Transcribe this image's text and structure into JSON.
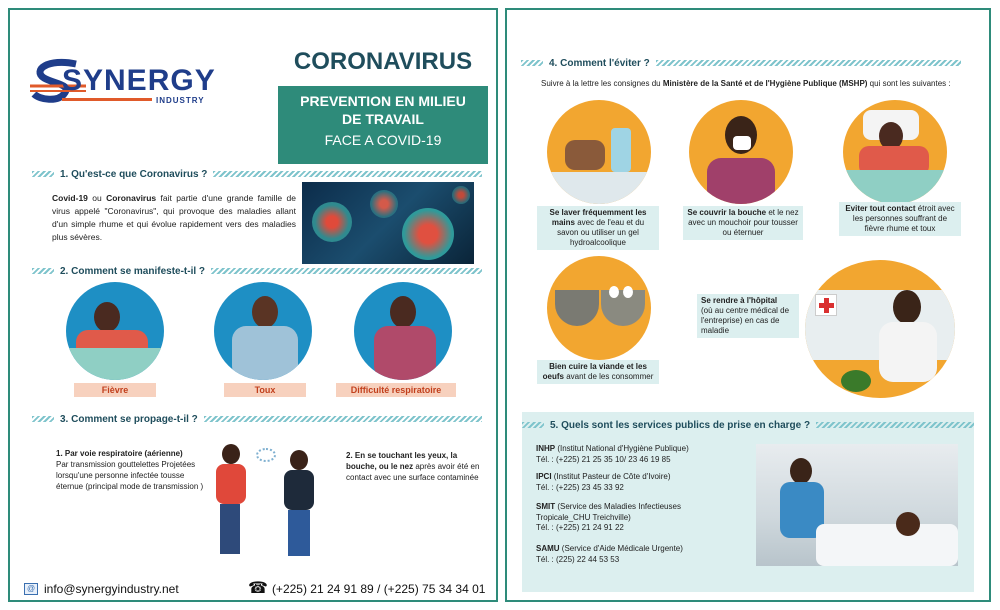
{
  "left": {
    "logo": {
      "name": "SYNERGY",
      "sub": "INDUSTRY"
    },
    "title": "CORONAVIRUS",
    "box_line1": "PREVENTION EN MILIEU",
    "box_line2": "DE TRAVAIL",
    "box_line3": "FACE A COVID-19",
    "s1": {
      "heading": "1. Qu'est-ce que Coronavirus ?",
      "t1": "Covid-19",
      "t2": " ou ",
      "t3": "Coronavirus",
      "t4": " fait partie d'une grande famille de virus appelé \"Coronavirus\", qui provoque des maladies allant d'un simple rhume et qui évolue rapidement vers des maladies plus sévères."
    },
    "s2": {
      "heading": "2. Comment se manifeste-t-il ?",
      "symptoms": [
        "Fièvre",
        "Toux",
        "Difficulté respiratoire"
      ]
    },
    "s3": {
      "heading": "3. Comment se propage-t-il ?",
      "r1_title": "1. Par voie respiratoire (aérienne)",
      "r1_text": "Par transmission gouttelettes Projetées lorsqu'une personne infectée tousse éternue (principal mode de transmission )",
      "r2_bold": "2. En se touchant les yeux, la bouche, ou le nez",
      "r2_text": " après avoir été en contact avec une surface contaminée"
    },
    "footer": {
      "email": "info@synergyindustry.net",
      "phone": "(+225)  21 24 91 89 / (+225) 75 34 34 01"
    }
  },
  "right": {
    "s4": {
      "heading": "4. Comment l'éviter ?",
      "intro1": "Suivre à la lettre les consignes du ",
      "intro_bold": "Ministère de la Santé et de l'Hygiène Publique (MSHP)",
      "intro2": " qui sont les suivantes :",
      "c1_bold": "Se laver fréquemment les mains",
      "c1_text": " avec  de l'eau et du savon ou utiliser un gel hydroalcoolique",
      "c2_bold": "Se couvrir la bouche",
      "c2_text": " et le nez avec un mouchoir pour tousser ou éternuer",
      "c3_bold": "Eviter tout contact",
      "c3_text": " étroit avec les personnes souffrant de fièvre rhume et toux",
      "c4_bold": "Bien cuire la viande et les oeufs",
      "c4_text": " avant de les consommer",
      "c5_bold": "Se rendre à l'hôpital",
      "c5_text": "(où au centre médical de l'entreprise) en cas de maladie"
    },
    "s5": {
      "heading": "5. Quels sont les services publics de prise en charge ?",
      "items": [
        {
          "name": "INHP",
          "desc": " (Institut National d'Hygiène Publique)",
          "tel": "Tél. : (+225) 21 25 35 10/ 23 46 19 85"
        },
        {
          "name": "IPCI",
          "desc": " (Institut Pasteur de Côte d'Ivoire)",
          "tel": "Tél. : (+225) 23 45 33 92"
        },
        {
          "name": "SMIT",
          "desc": " (Service des Maladies Infectieuses Tropicale_CHU Treichville)",
          "tel": "Tél. : (+225) 21 24 91 22"
        },
        {
          "name": "SAMU",
          "desc": " (Service d'Aide Médicale Urgente)",
          "tel": "Tél. : (225) 22 44 53 53"
        }
      ]
    }
  }
}
